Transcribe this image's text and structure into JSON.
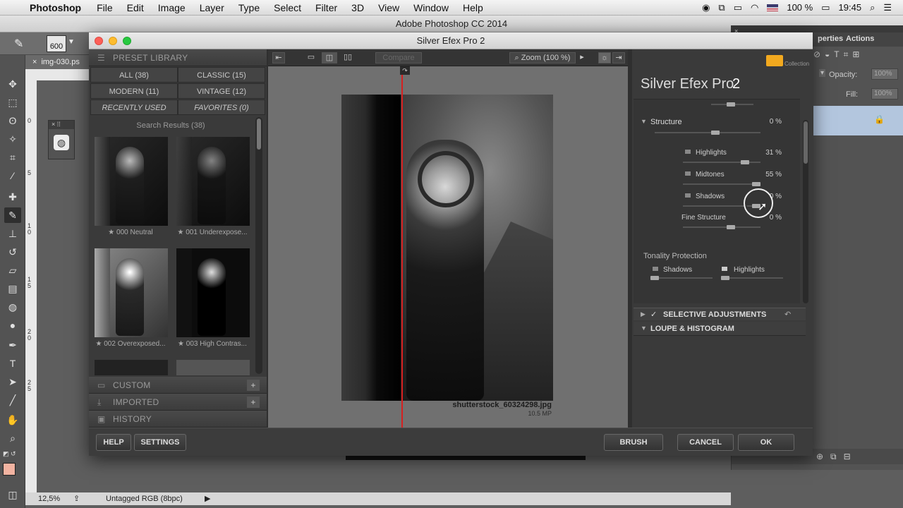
{
  "menubar": {
    "app_name": "Photoshop",
    "items": [
      "File",
      "Edit",
      "Image",
      "Layer",
      "Type",
      "Select",
      "Filter",
      "3D",
      "View",
      "Window",
      "Help"
    ],
    "battery": "100 %",
    "time": "19:45"
  },
  "photoshop": {
    "window_title": "Adobe Photoshop CC 2014",
    "brush_size": "600",
    "doc_tab": "img-030.ps",
    "zoom": "12,5%",
    "color_profile": "Untagged RGB (8bpc)",
    "panel_tabs": [
      "perties",
      "Actions"
    ],
    "opacity_label": "Opacity:",
    "opacity_value": "100%",
    "fill_label": "Fill:",
    "fill_value": "100%",
    "ruler_marks": [
      "0",
      "5",
      "1 0",
      "1 5",
      "2 0",
      "2 5"
    ]
  },
  "sefx": {
    "window_title": "Silver Efex Pro 2",
    "brand_name": "Silver Efex Pro",
    "brand_version": "2",
    "collection_label": "Collection",
    "left": {
      "preset_library": "PRESET LIBRARY",
      "categories": [
        "ALL (38)",
        "CLASSIC (15)",
        "MODERN (11)",
        "VINTAGE (12)",
        "RECENTLY USED",
        "FAVORITES (0)"
      ],
      "search_results": "Search Results (38)",
      "presets": [
        "★ 000 Neutral",
        "★ 001 Underexpose...",
        "★ 002 Overexposed...",
        "★ 003 High Contras..."
      ],
      "custom": "CUSTOM",
      "imported": "IMPORTED",
      "history": "HISTORY"
    },
    "center": {
      "compare": "Compare",
      "zoom": "Zoom (100 %)",
      "filename": "shutterstock_60324298.jpg",
      "filesize": "10.5 MP"
    },
    "right": {
      "structure_label": "Structure",
      "structure_value": "0 %",
      "highlights_label": "Highlights",
      "highlights_value": "31 %",
      "midtones_label": "Midtones",
      "midtones_value": "55 %",
      "shadows_label": "Shadows",
      "shadows_value": "0 %",
      "fine_structure_label": "Fine Structure",
      "fine_structure_value": "0 %",
      "tonality_protection": "Tonality Protection",
      "tp_shadows": "Shadows",
      "tp_highlights": "Highlights",
      "selective_adjustments": "SELECTIVE ADJUSTMENTS",
      "loupe_histogram": "LOUPE & HISTOGRAM"
    },
    "footer": {
      "help": "HELP",
      "settings": "SETTINGS",
      "brush": "BRUSH",
      "cancel": "CANCEL",
      "ok": "OK"
    }
  }
}
